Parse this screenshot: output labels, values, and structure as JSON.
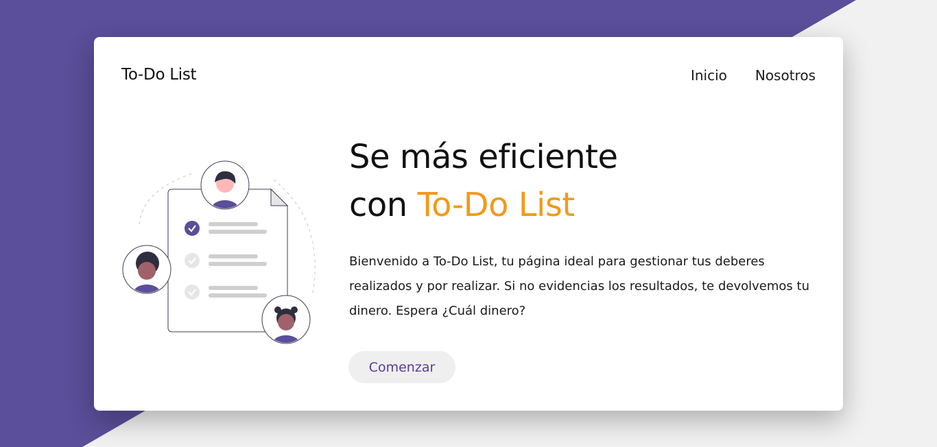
{
  "header": {
    "brand": "To-Do List",
    "nav": [
      "Inicio",
      "Nosotros"
    ]
  },
  "hero": {
    "title_line1": "Se más eficiente",
    "title_line2_prefix": "con ",
    "title_line2_accent": "To-Do List",
    "description": "Bienvenido a To-Do List, tu página ideal para gestionar tus deberes realizados y por realizar. Si no evidencias los resultados, te devolvemos tu dinero. Espera ¿Cuál dinero?",
    "cta": "Comenzar"
  },
  "colors": {
    "purple": "#5b4e9a",
    "accent": "#f29a1b",
    "background": "#f1f1f1",
    "card": "#ffffff"
  },
  "illustration": {
    "icon": "team-checklist-illustration"
  }
}
